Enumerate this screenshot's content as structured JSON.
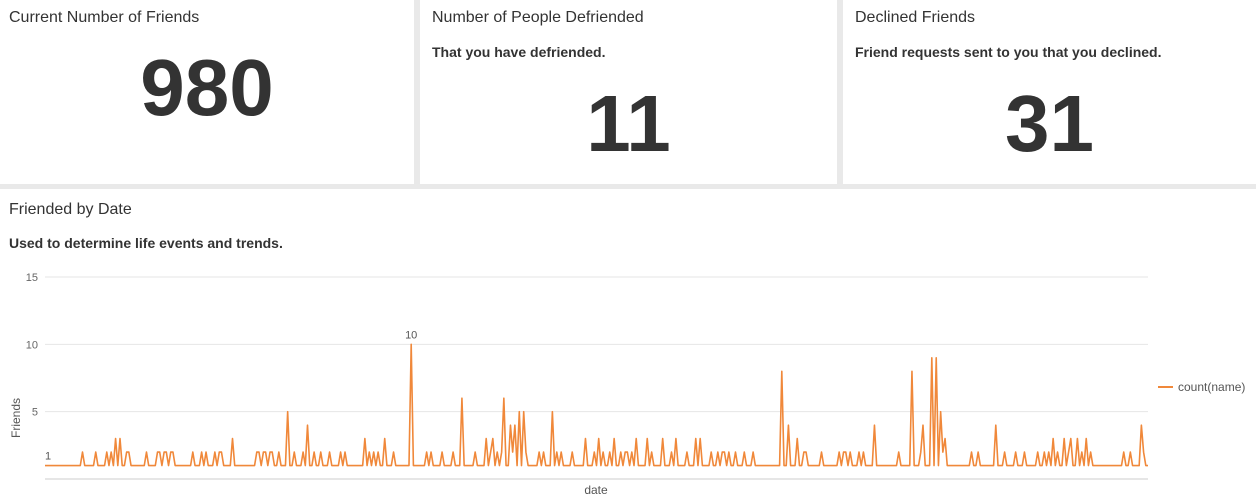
{
  "panels": [
    {
      "title": "Current Number of Friends",
      "subtitle": "",
      "value": "980"
    },
    {
      "title": "Number of People Defriended",
      "subtitle": "That you have defriended.",
      "value": "11"
    },
    {
      "title": "Declined Friends",
      "subtitle": "Friend requests sent to you that you declined.",
      "value": "31"
    }
  ],
  "chart_panel": {
    "title": "Friended by Date",
    "subtitle": "Used to determine life events and trends."
  },
  "colors": {
    "series": "#f0883a",
    "grid": "#e6e6e6",
    "panel_bg": "#ffffff",
    "page_bg": "#e9e9e9",
    "text": "#333333"
  },
  "chart_data": {
    "type": "line",
    "title": "Friended by Date",
    "xlabel": "date",
    "ylabel": "Friends",
    "ylim": [
      0,
      15
    ],
    "yticks": [
      5,
      10,
      15
    ],
    "grid": true,
    "legend": "right",
    "series": [
      {
        "name": "count(name)",
        "values": [
          1,
          1,
          1,
          1,
          1,
          1,
          1,
          1,
          1,
          1,
          1,
          1,
          1,
          1,
          1,
          1,
          1,
          2,
          1,
          1,
          1,
          1,
          1,
          2,
          1,
          1,
          1,
          1,
          2,
          1,
          2,
          1,
          3,
          1,
          3,
          1,
          1,
          2,
          2,
          1,
          1,
          1,
          1,
          1,
          1,
          1,
          2,
          1,
          1,
          1,
          1,
          2,
          2,
          1,
          2,
          2,
          1,
          2,
          2,
          1,
          1,
          1,
          1,
          1,
          1,
          1,
          1,
          2,
          1,
          1,
          1,
          2,
          1,
          2,
          1,
          1,
          1,
          2,
          1,
          2,
          2,
          1,
          1,
          1,
          1,
          3,
          1,
          1,
          1,
          1,
          1,
          1,
          1,
          1,
          1,
          1,
          2,
          2,
          1,
          2,
          2,
          1,
          2,
          2,
          1,
          1,
          2,
          1,
          1,
          1,
          5,
          1,
          1,
          2,
          1,
          1,
          1,
          2,
          1,
          4,
          1,
          1,
          2,
          1,
          1,
          2,
          1,
          1,
          1,
          2,
          1,
          1,
          1,
          1,
          2,
          1,
          2,
          1,
          1,
          1,
          1,
          1,
          1,
          1,
          1,
          3,
          1,
          2,
          1,
          2,
          1,
          2,
          1,
          1,
          3,
          1,
          1,
          1,
          2,
          1,
          1,
          1,
          1,
          1,
          1,
          1,
          10,
          1,
          1,
          1,
          1,
          1,
          1,
          2,
          1,
          2,
          1,
          1,
          1,
          1,
          2,
          1,
          1,
          1,
          1,
          2,
          1,
          1,
          1,
          6,
          1,
          1,
          1,
          1,
          1,
          2,
          1,
          1,
          1,
          1,
          3,
          1,
          2,
          3,
          1,
          2,
          1,
          2,
          6,
          1,
          1,
          4,
          2,
          4,
          1,
          5,
          1,
          5,
          2,
          1,
          1,
          1,
          1,
          1,
          2,
          1,
          2,
          1,
          1,
          1,
          5,
          1,
          2,
          1,
          2,
          1,
          1,
          1,
          1,
          2,
          1,
          1,
          1,
          1,
          1,
          3,
          1,
          1,
          1,
          2,
          1,
          3,
          1,
          2,
          1,
          1,
          2,
          1,
          3,
          1,
          1,
          2,
          1,
          2,
          2,
          1,
          2,
          1,
          3,
          1,
          1,
          1,
          1,
          3,
          1,
          2,
          1,
          1,
          1,
          1,
          3,
          1,
          1,
          1,
          2,
          1,
          3,
          1,
          1,
          1,
          1,
          2,
          1,
          1,
          1,
          3,
          1,
          3,
          1,
          1,
          1,
          1,
          2,
          1,
          1,
          2,
          1,
          2,
          2,
          1,
          2,
          1,
          1,
          2,
          1,
          1,
          1,
          2,
          1,
          1,
          1,
          2,
          1,
          1,
          1,
          1,
          1,
          1,
          1,
          1,
          1,
          1,
          1,
          1,
          8,
          1,
          1,
          4,
          1,
          1,
          1,
          3,
          1,
          1,
          2,
          2,
          1,
          1,
          1,
          1,
          1,
          1,
          2,
          1,
          1,
          1,
          1,
          1,
          1,
          1,
          2,
          1,
          2,
          2,
          1,
          2,
          1,
          1,
          1,
          2,
          1,
          2,
          1,
          1,
          1,
          1,
          4,
          1,
          1,
          1,
          1,
          1,
          1,
          1,
          1,
          1,
          1,
          2,
          1,
          1,
          1,
          1,
          1,
          8,
          1,
          1,
          1,
          2,
          4,
          1,
          1,
          1,
          9,
          1,
          9,
          1,
          5,
          2,
          3,
          1,
          1,
          1,
          1,
          1,
          1,
          1,
          1,
          1,
          1,
          1,
          2,
          1,
          1,
          2,
          1,
          1,
          1,
          1,
          1,
          1,
          1,
          4,
          1,
          1,
          1,
          2,
          1,
          1,
          1,
          1,
          2,
          1,
          1,
          1,
          2,
          1,
          1,
          1,
          1,
          1,
          2,
          1,
          1,
          2,
          1,
          2,
          1,
          3,
          1,
          2,
          1,
          1,
          3,
          1,
          2,
          3,
          1,
          1,
          3,
          1,
          2,
          1,
          3,
          1,
          2,
          1,
          1,
          1,
          1,
          1,
          1,
          1,
          1,
          1,
          1,
          1,
          1,
          1,
          1,
          2,
          1,
          1,
          2,
          1,
          1,
          1,
          1,
          4,
          2,
          1,
          1
        ]
      }
    ],
    "annotations": [
      {
        "label": "1"
      },
      {
        "label": "10"
      }
    ]
  }
}
